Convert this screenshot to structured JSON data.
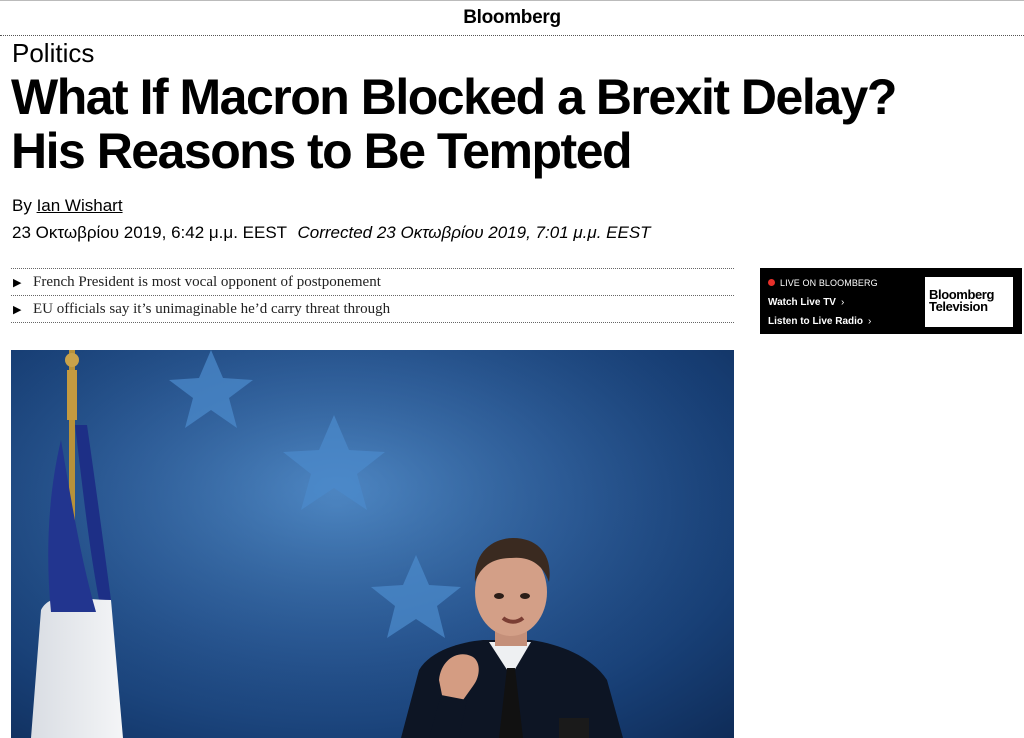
{
  "site": {
    "brand": "Bloomberg"
  },
  "article": {
    "section": "Politics",
    "headline_line1": "What If Macron Blocked a Brexit Delay?",
    "headline_line2": "His Reasons to Be Tempted",
    "byline_prefix": "By",
    "author": "Ian Wishart",
    "published": "23 Οκτωβρίου 2019, 6:42 μ.μ. EEST",
    "corrected": "Corrected 23 Οκτωβρίου 2019, 7:01 μ.μ. EEST",
    "summary": [
      "French President is most vocal opponent of postponement",
      "EU officials say it’s unimaginable he’d carry threat through"
    ]
  },
  "promo": {
    "live_label": "LIVE ON BLOOMBERG",
    "watch_label": "Watch Live TV",
    "radio_label": "Listen to Live Radio",
    "logo_line1": "Bloomberg",
    "logo_line2": "Television",
    "live_color": "#e8302a"
  },
  "icons": {
    "bullet": "triangle-right-icon",
    "chevron": "chevron-right-icon"
  }
}
